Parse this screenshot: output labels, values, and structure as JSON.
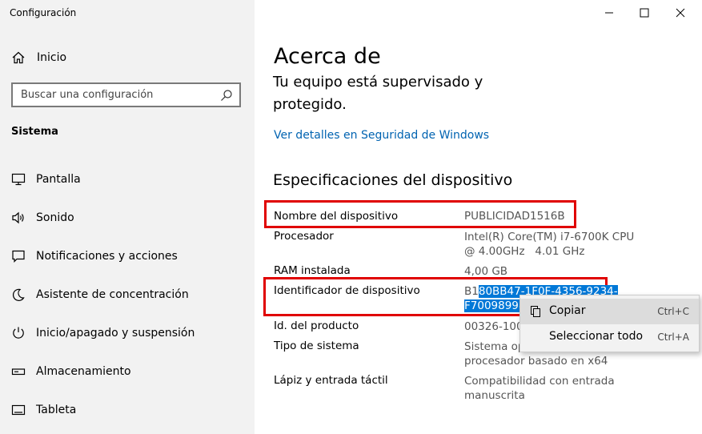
{
  "window": {
    "title": "Configuración"
  },
  "sidebar": {
    "home_label": "Inicio",
    "search_placeholder": "Buscar una configuración",
    "section_title": "Sistema",
    "items": [
      {
        "label": "Pantalla",
        "icon": "monitor-icon"
      },
      {
        "label": "Sonido",
        "icon": "speaker-icon"
      },
      {
        "label": "Notificaciones y acciones",
        "icon": "notification-icon"
      },
      {
        "label": "Asistente de concentración",
        "icon": "moon-icon"
      },
      {
        "label": "Inicio/apagado y suspensión",
        "icon": "power-icon"
      },
      {
        "label": "Almacenamiento",
        "icon": "storage-icon"
      },
      {
        "label": "Tableta",
        "icon": "tablet-icon"
      }
    ]
  },
  "main": {
    "title": "Acerca de",
    "protection_text": "Tu equipo está supervisado y protegido.",
    "security_link": "Ver detalles en Seguridad de Windows",
    "specs_title": "Especificaciones del dispositivo",
    "specs": [
      {
        "label": "Nombre del dispositivo",
        "value": "PUBLICIDAD1516B"
      },
      {
        "label": "Procesador",
        "value_line1": "Intel(R) Core(TM) i7-6700K CPU",
        "value_line2": "@ 4.00GHz   4.01 GHz"
      },
      {
        "label": "RAM instalada",
        "value": "4,00 GB"
      },
      {
        "label": "Identificador de dispositivo",
        "value_prefix": "B1",
        "value_sel1": "80BB47-1F0F-4356-9234-",
        "value_sel2": "F70098998"
      },
      {
        "label": "Id. del producto",
        "value": "00326-1000"
      },
      {
        "label": "Tipo de sistema",
        "value_line1": "Sistema op",
        "value_line2": "procesador basado en x64"
      },
      {
        "label": "Lápiz y entrada táctil",
        "value_line1": "Compatibilidad con entrada",
        "value_line2": "manuscrita"
      }
    ]
  },
  "context_menu": {
    "items": [
      {
        "label": "Copiar",
        "shortcut": "Ctrl+C",
        "icon": "copy-icon"
      },
      {
        "label": "Seleccionar todo",
        "shortcut": "Ctrl+A"
      }
    ]
  },
  "colors": {
    "sidebar_bg": "#f2f2f2",
    "link": "#0063b1",
    "highlight_box": "#e00000",
    "selection": "#0078d7"
  }
}
